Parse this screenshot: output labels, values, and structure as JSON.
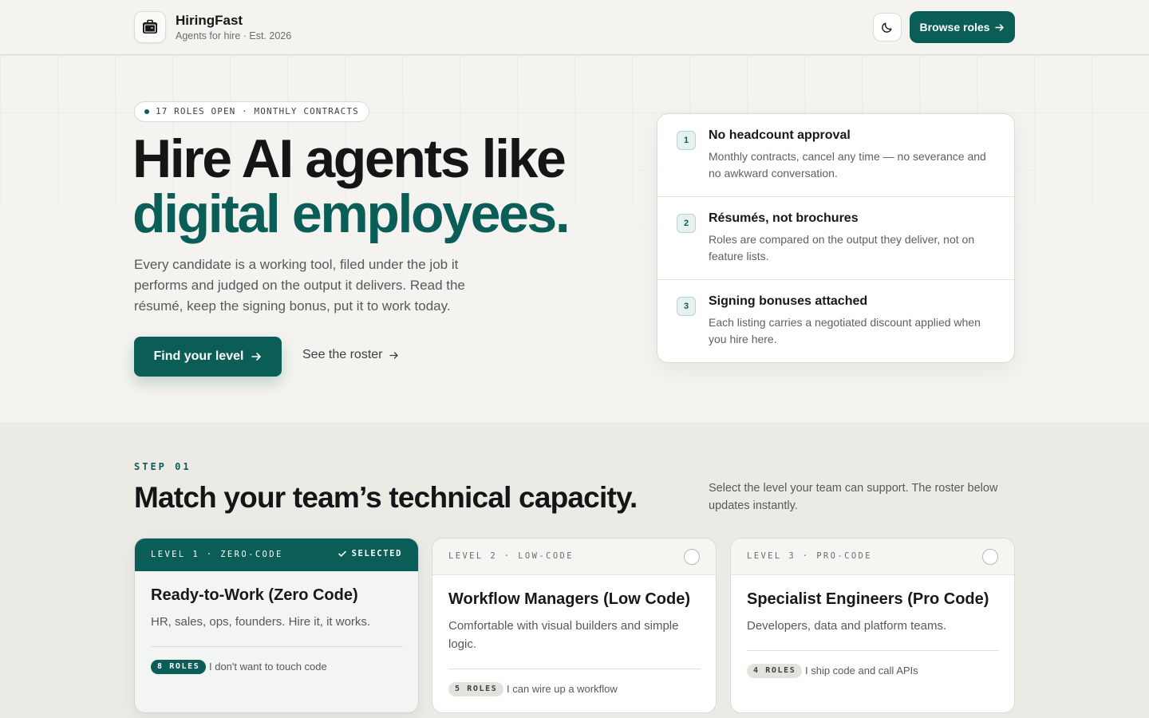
{
  "header": {
    "brand_name": "HiringFast",
    "brand_tagline": "Agents for hire · Est. 2026",
    "theme_toggle_icon": "moon-icon",
    "browse_label": "Browse roles"
  },
  "hero": {
    "pill": "17 ROLES OPEN · MONTHLY CONTRACTS",
    "headline_line1": "Hire AI agents like",
    "headline_line2": "digital employees.",
    "lede": "Every candidate is a working tool, filed under the job it performs and judged on the output it delivers. Read the résumé, keep the signing bonus, put it to work today.",
    "primary_cta": "Find your level",
    "secondary_cta": "See the roster"
  },
  "features": [
    {
      "num": "1",
      "title": "No headcount approval",
      "body": "Monthly contracts, cancel any time — no severance and no awkward conversation."
    },
    {
      "num": "2",
      "title": "Résumés, not brochures",
      "body": "Roles are compared on the output they deliver, not on feature lists."
    },
    {
      "num": "3",
      "title": "Signing bonuses attached",
      "body": "Each listing carries a negotiated discount applied when you hire here."
    }
  ],
  "step": {
    "label": "STEP 01",
    "title": "Match your team’s technical capacity.",
    "note": "Select the level your team can support. The roster below updates instantly."
  },
  "levels": [
    {
      "tag": "LEVEL 1 · ZERO-CODE",
      "selected": true,
      "selected_label": "SELECTED",
      "title": "Ready-to-Work (Zero Code)",
      "desc": "HR, sales, ops, founders. Hire it, it works.",
      "badge": "8 ROLES",
      "badge_note": "I don't want to touch code"
    },
    {
      "tag": "LEVEL 2 · LOW-CODE",
      "selected": false,
      "title": "Workflow Managers (Low Code)",
      "desc": "Comfortable with visual builders and simple logic.",
      "badge": "5 ROLES",
      "badge_note": "I can wire up a workflow"
    },
    {
      "tag": "LEVEL 3 · PRO-CODE",
      "selected": false,
      "title": "Specialist Engineers (Pro Code)",
      "desc": "Developers, data and platform teams.",
      "badge": "4 ROLES",
      "badge_note": "I ship code and call APIs"
    }
  ],
  "colors": {
    "accent": "#0b5d57",
    "background": "#f4f3ef",
    "section_background": "#eceae5"
  }
}
